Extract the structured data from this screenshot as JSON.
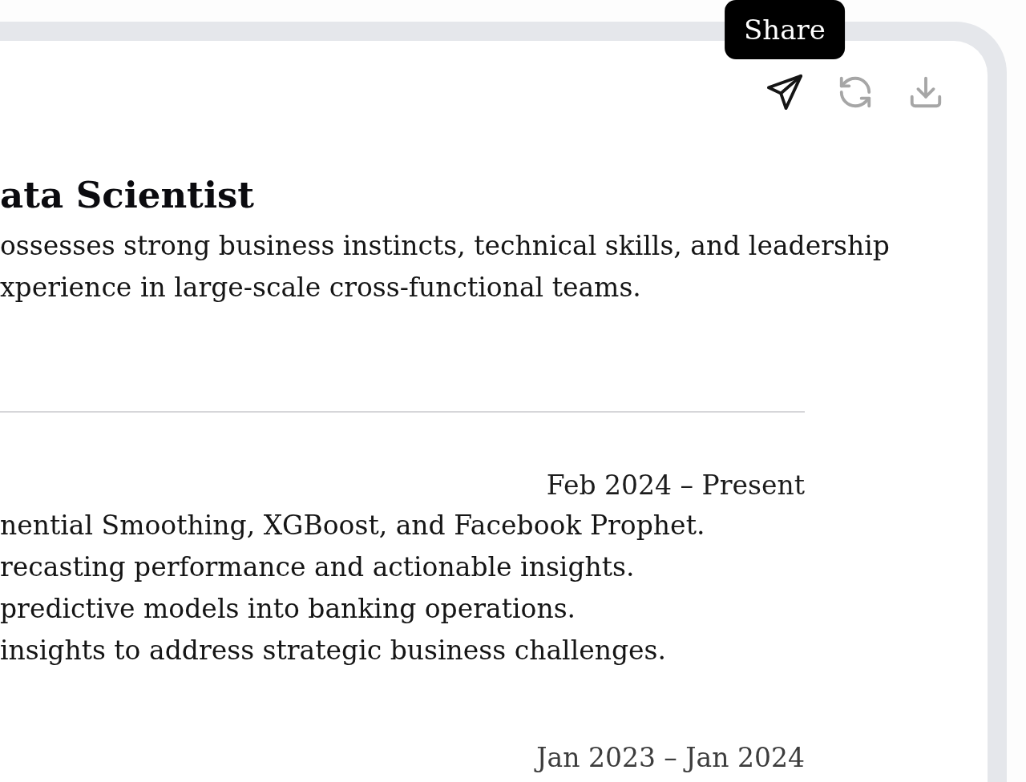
{
  "toolbar": [
    {
      "kind": "share",
      "hovered": true,
      "tooltip": "Share"
    },
    {
      "kind": "refresh",
      "hovered": false
    },
    {
      "kind": "download",
      "hovered": false
    }
  ],
  "resume": {
    "title": "ata Scientist",
    "summary_lines": [
      "ossesses strong business instincts, technical skills, and leadership",
      "xperience in large-scale cross-functional teams."
    ]
  },
  "experience": [
    {
      "dates": "Feb 2024 – Present",
      "bullets": [
        "nential Smoothing, XGBoost, and Facebook Prophet.",
        "recasting performance and actionable insights.",
        "predictive models into banking operations.",
        "insights to address strategic business challenges."
      ]
    },
    {
      "dates": "Jan 2023 – Jan 2024"
    }
  ]
}
